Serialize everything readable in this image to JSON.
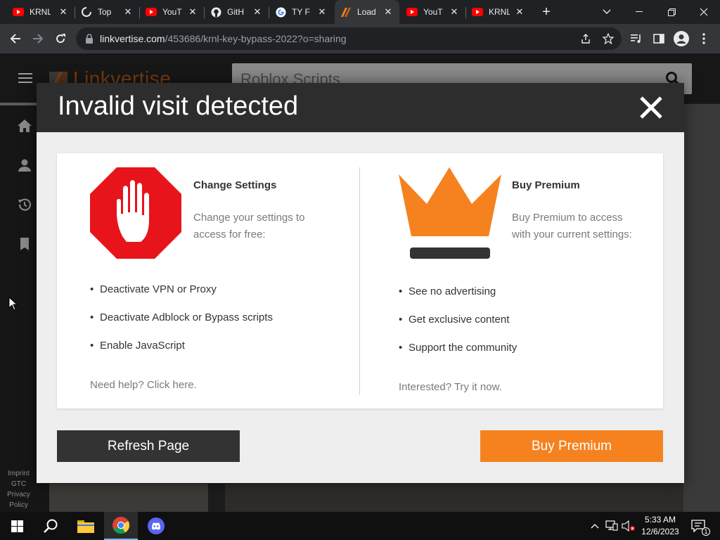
{
  "browser": {
    "tabs": [
      {
        "title": "KRNL",
        "favicon": "youtube-icon"
      },
      {
        "title": "Top",
        "favicon": "loading-icon"
      },
      {
        "title": "YouT",
        "favicon": "youtube-icon"
      },
      {
        "title": "GitH",
        "favicon": "github-icon"
      },
      {
        "title": "TY F",
        "favicon": "google-icon"
      },
      {
        "title": "Load",
        "favicon": "linkvertise-icon",
        "active": true
      },
      {
        "title": "YouT",
        "favicon": "youtube-icon"
      },
      {
        "title": "KRNL",
        "favicon": "youtube-icon"
      }
    ],
    "url_host": "linkvertise.com",
    "url_path": "/453686/krnl-key-bypass-2022?o=sharing"
  },
  "site": {
    "logo_text": "Linkvertise",
    "search_value": "Roblox Scripts",
    "footer_links": [
      "Imprint",
      "GTC",
      "Privacy",
      "Policy"
    ]
  },
  "modal": {
    "title": "Invalid visit detected",
    "left": {
      "title": "Change Settings",
      "desc": "Change your settings to access for free:",
      "bullets": [
        "Deactivate VPN or Proxy",
        "Deactivate Adblock or Bypass scripts",
        "Enable JavaScript"
      ],
      "help": "Need help? Click here."
    },
    "right": {
      "title": "Buy Premium",
      "desc": "Buy Premium to access with your current settings:",
      "bullets": [
        "See no advertising",
        "Get exclusive content",
        "Support the community"
      ],
      "help": "Interested? Try it now."
    },
    "refresh_button": "Refresh Page",
    "premium_button": "Buy Premium"
  },
  "taskbar": {
    "time": "5:33 AM",
    "date": "12/6/2023",
    "notification_count": "1"
  },
  "colors": {
    "accent_orange": "#f5821f",
    "stop_red": "#e8141b",
    "crown_orange": "#f5821f",
    "modal_header": "#2d2d2d"
  }
}
